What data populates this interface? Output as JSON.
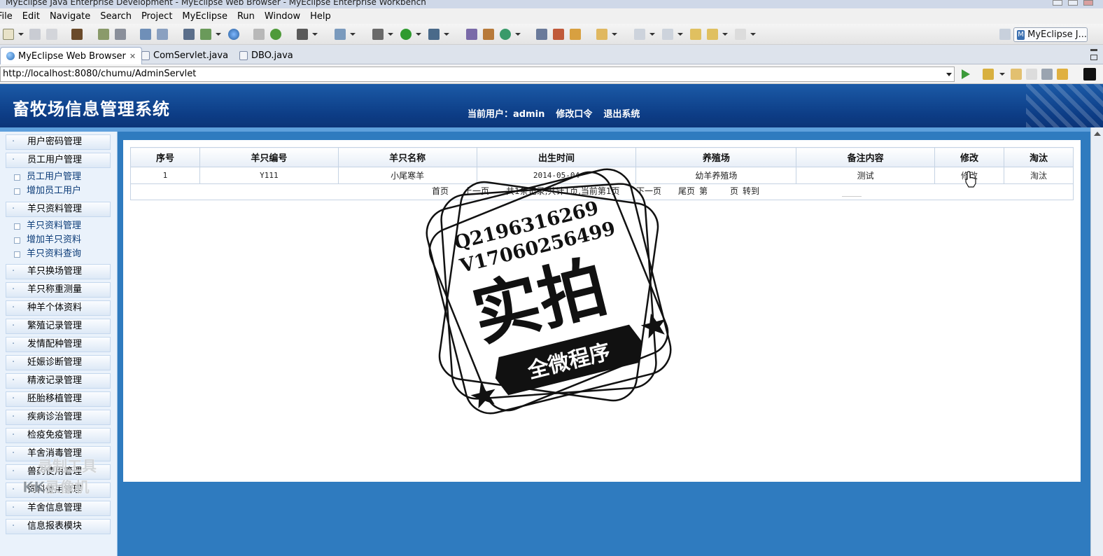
{
  "window": {
    "title": "MyEclipse Java Enterprise Development - MyEclipse Web Browser - MyEclipse Enterprise Workbench"
  },
  "menu": [
    "File",
    "Edit",
    "Navigate",
    "Search",
    "Project",
    "MyEclipse",
    "Run",
    "Window",
    "Help"
  ],
  "perspective": {
    "label": "MyEclipse J..."
  },
  "tabs": [
    {
      "label": "MyEclipse Web Browser",
      "icon": "globe-icon",
      "active": true
    },
    {
      "label": "ComServlet.java",
      "icon": "java-file-icon",
      "active": false
    },
    {
      "label": "DBO.java",
      "icon": "java-file-icon",
      "active": false
    }
  ],
  "address": {
    "url": "http://localhost:8080/chumu/AdminServlet"
  },
  "site": {
    "title": "畜牧场信息管理系统",
    "user_prefix": "当前用户：",
    "username": "admin",
    "change_password": "修改口令",
    "logout": "退出系统"
  },
  "sidebar": {
    "groups": [
      {
        "label": "用户密码管理",
        "items": []
      },
      {
        "label": "员工用户管理",
        "items": [
          "员工用户管理",
          "增加员工用户"
        ]
      },
      {
        "label": "羊只资料管理",
        "items": [
          "羊只资料管理",
          "增加羊只资料",
          "羊只资料查询"
        ]
      },
      {
        "label": "羊只换场管理",
        "items": []
      },
      {
        "label": "羊只称重测量",
        "items": []
      },
      {
        "label": "种羊个体资料",
        "items": []
      },
      {
        "label": "繁殖记录管理",
        "items": []
      },
      {
        "label": "发情配种管理",
        "items": []
      },
      {
        "label": "妊娠诊断管理",
        "items": []
      },
      {
        "label": "精液记录管理",
        "items": []
      },
      {
        "label": "胚胎移植管理",
        "items": []
      },
      {
        "label": "疾病诊治管理",
        "items": []
      },
      {
        "label": "检疫免疫管理",
        "items": []
      },
      {
        "label": "羊舍消毒管理",
        "items": []
      },
      {
        "label": "兽药使用管理",
        "items": []
      },
      {
        "label": "饲料使用管理",
        "items": []
      },
      {
        "label": "羊舍信息管理",
        "items": []
      },
      {
        "label": "信息报表模块",
        "items": []
      }
    ]
  },
  "table": {
    "headers": [
      "序号",
      "羊只编号",
      "羊只名称",
      "出生时间",
      "养殖场",
      "备注内容",
      "修改",
      "淘汰"
    ],
    "rows": [
      [
        "1",
        "Y111",
        "小尾寒羊",
        "2014-05-04",
        "幼羊养殖场",
        "测试",
        "修改",
        "淘汰"
      ]
    ]
  },
  "pager": {
    "first": "首页",
    "prev": "上一页",
    "info": "共1条记录,共计1页,当前第1页",
    "next": "下一页",
    "last": "尾页",
    "goto_prefix": "第",
    "goto_suffix": "页",
    "goto": "转到"
  },
  "overlay": {
    "stamp_line1": "Q2196316269",
    "stamp_line2": "V17060256499",
    "stamp_big": "实拍",
    "stamp_banner": "全微程序",
    "watermark_line1": "录制工具",
    "watermark_line2": "KK录像机"
  },
  "colors": {
    "header": "#0d3d86",
    "page_bg": "#2f7bbf",
    "sidebar_bg": "#eaf2fb"
  }
}
